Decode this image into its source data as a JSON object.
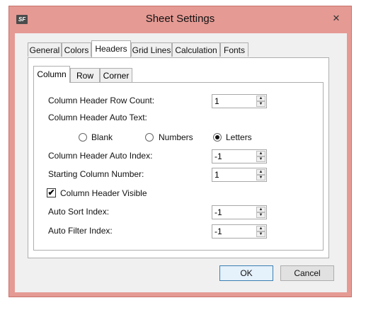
{
  "window": {
    "title": "Sheet Settings",
    "icon_text": "SF",
    "close_glyph": "✕",
    "title_bar_color": "#e59a94"
  },
  "tabs": [
    "General",
    "Colors",
    "Headers",
    "Grid Lines",
    "Calculation",
    "Fonts"
  ],
  "active_tab": "Headers",
  "subtabs": [
    "Column",
    "Row",
    "Corner"
  ],
  "active_subtab": "Column",
  "fields": {
    "row_count": {
      "label": "Column Header Row Count:",
      "value": "1"
    },
    "auto_text": {
      "label": "Column Header Auto Text:"
    },
    "radios": [
      {
        "label": "Blank",
        "selected": false
      },
      {
        "label": "Numbers",
        "selected": false
      },
      {
        "label": "Letters",
        "selected": true
      }
    ],
    "auto_index": {
      "label": "Column Header Auto Index:",
      "value": "-1"
    },
    "starting_number": {
      "label": "Starting Column Number:",
      "value": "1"
    },
    "visible": {
      "label": "Column Header Visible",
      "checked": true,
      "check_glyph": "✔"
    },
    "auto_sort": {
      "label": "Auto Sort Index:",
      "value": "-1"
    },
    "auto_filter": {
      "label": "Auto Filter Index:",
      "value": "-1"
    }
  },
  "spin_glyphs": {
    "up": "▲",
    "down": "▼"
  },
  "buttons": {
    "ok": "OK",
    "cancel": "Cancel"
  }
}
